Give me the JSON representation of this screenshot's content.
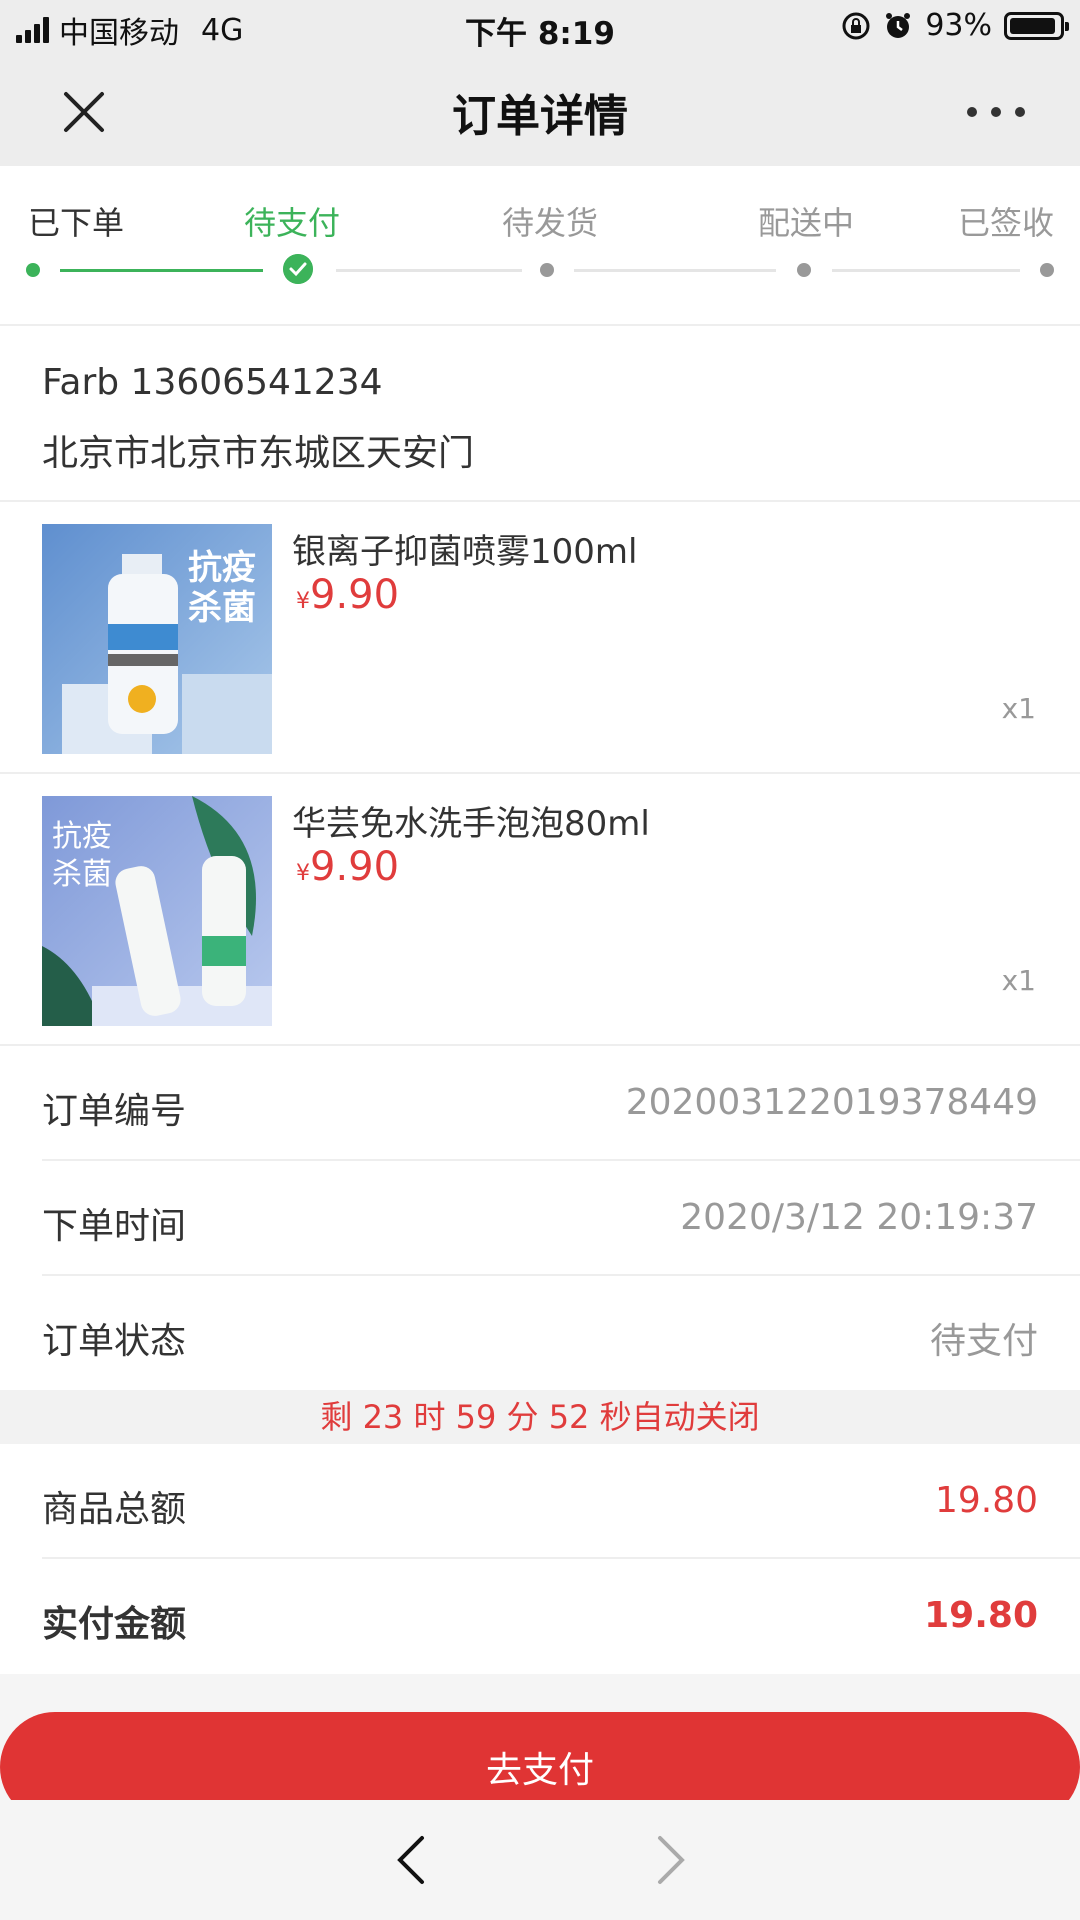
{
  "status_bar": {
    "carrier": "中国移动",
    "network": "4G",
    "time": "下午 8:19",
    "battery": "93%",
    "battery_level": 0.93
  },
  "nav": {
    "title": "订单详情",
    "close_icon": "close-icon",
    "more_icon": "more-icon"
  },
  "steps": [
    {
      "label": "已下单",
      "state": "done"
    },
    {
      "label": "待支付",
      "state": "active"
    },
    {
      "label": "待发货",
      "state": "pending"
    },
    {
      "label": "配送中",
      "state": "pending"
    },
    {
      "label": "已签收",
      "state": "pending"
    }
  ],
  "address": {
    "name_phone": "Farb 13606541234",
    "address": "北京市北京市东城区天安门"
  },
  "items": [
    {
      "name": "银离子抑菌喷雾100ml",
      "currency": "¥",
      "price": "9.90",
      "qty": "x1",
      "image_text": "抗疫 杀菌"
    },
    {
      "name": "华芸免水洗手泡泡80ml",
      "currency": "¥",
      "price": "9.90",
      "qty": "x1",
      "image_text": "抗疫 杀菌"
    }
  ],
  "order_info": {
    "order_no_label": "订单编号",
    "order_no": "20200312201937844​9",
    "order_time_label": "下单时间",
    "order_time": "2020/3/12 20:19:37",
    "order_status_label": "订单状态",
    "order_status": "待支付"
  },
  "countdown": "剩 23 时 59 分 52 秒自动关闭",
  "totals": {
    "goods_total_label": "商品总额",
    "goods_total": "19.80",
    "paid_label": "实付金额",
    "paid": "19.80"
  },
  "pay_button": "去支付",
  "colors": {
    "accent_green": "#3cb35a",
    "price_red": "#e03c3c",
    "button_red": "#e03434"
  }
}
